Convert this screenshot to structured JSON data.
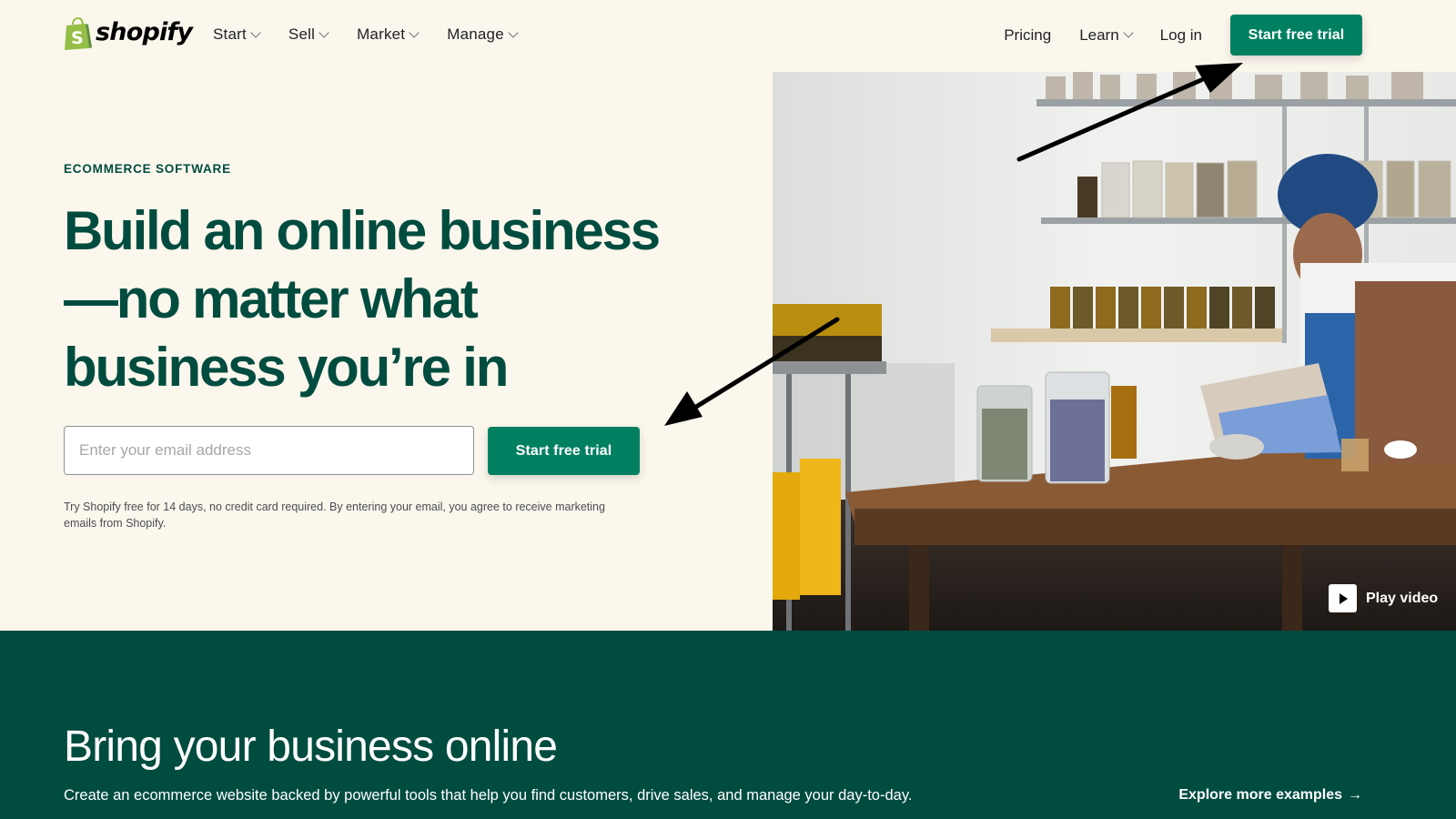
{
  "nav": {
    "logo_text": "shopify",
    "left_items": [
      {
        "label": "Start"
      },
      {
        "label": "Sell"
      },
      {
        "label": "Market"
      },
      {
        "label": "Manage"
      }
    ],
    "pricing_label": "Pricing",
    "learn_label": "Learn",
    "login_label": "Log in",
    "cta_label": "Start free trial"
  },
  "hero": {
    "eyebrow": "ECOMMERCE SOFTWARE",
    "headline": "Build an online business—no matter what business you’re in",
    "email_placeholder": "Enter your email address",
    "email_value": "",
    "cta_label": "Start free trial",
    "disclaimer": "Try Shopify free for 14 days, no credit card required. By entering your email, you agree to receive marketing emails from Shopify.",
    "play_label": "Play video"
  },
  "band": {
    "title": "Bring your business online",
    "subtitle": "Create an ecommerce website backed by powerful tools that help you find customers, drive sales, and manage your day-to-day.",
    "link_label": "Explore more examples",
    "link_arrow": "→"
  },
  "colors": {
    "brand_green": "#008060",
    "dark_green": "#004c3f",
    "background": "#fbf7ed",
    "logo_green": "#95bf47"
  }
}
